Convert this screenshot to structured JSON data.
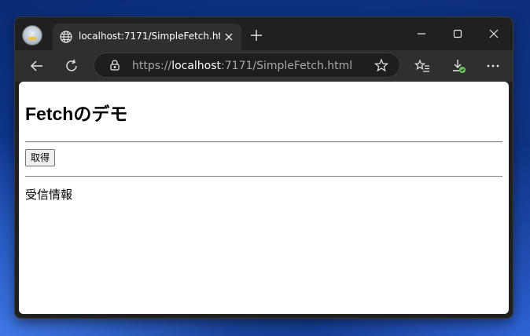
{
  "browser": {
    "tab_title": "localhost:7171/SimpleFetch.html",
    "url_scheme": "https://",
    "url_host": "localhost",
    "url_rest": ":7171/SimpleFetch.html"
  },
  "page": {
    "heading": "Fetchのデモ",
    "fetch_button_label": "取得",
    "received_text": "受信情報"
  },
  "icons": {
    "tab": "globe-icon",
    "close": "close-icon",
    "new_tab": "plus-icon",
    "back": "back-arrow-icon",
    "refresh": "refresh-icon",
    "lock": "lock-icon",
    "favorite": "star-icon",
    "favorites": "favorites-list-icon",
    "downloads": "download-icon",
    "menu": "more-icon"
  }
}
